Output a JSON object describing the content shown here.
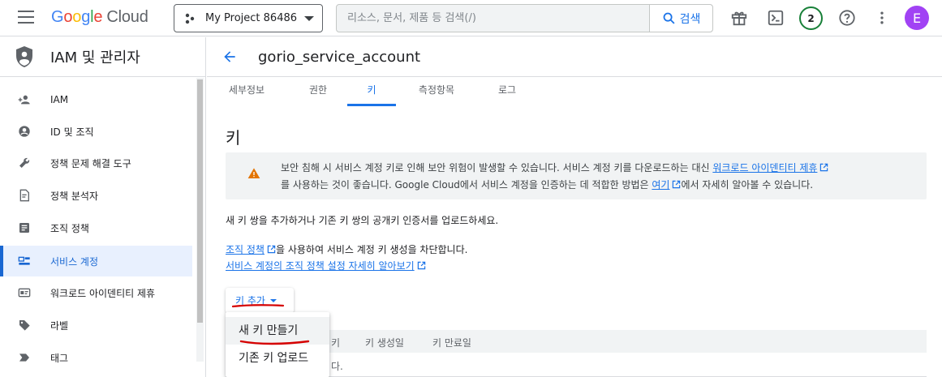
{
  "topbar": {
    "logo_letters": [
      "G",
      "o",
      "o",
      "g",
      "l",
      "e"
    ],
    "logo_suffix": "Cloud",
    "project": "My Project 86486",
    "search_placeholder": "리소스, 문서, 제품 등 검색(/)",
    "search_button": "검색",
    "notification_count": "2",
    "avatar_letter": "E"
  },
  "sidebar": {
    "title": "IAM 및 관리자",
    "items": [
      {
        "label": "IAM",
        "icon": "person-add-icon"
      },
      {
        "label": "ID 및 조직",
        "icon": "account-circle-icon"
      },
      {
        "label": "정책 문제 해결 도구",
        "icon": "wrench-icon"
      },
      {
        "label": "정책 분석자",
        "icon": "policy-doc-icon"
      },
      {
        "label": "조직 정책",
        "icon": "list-doc-icon"
      },
      {
        "label": "서비스 계정",
        "icon": "service-account-icon",
        "active": true
      },
      {
        "label": "워크로드 아이덴티티 제휴",
        "icon": "id-card-icon"
      },
      {
        "label": "라벨",
        "icon": "label-icon"
      },
      {
        "label": "태그",
        "icon": "tag-icon"
      }
    ]
  },
  "main": {
    "title": "gorio_service_account",
    "tabs": [
      {
        "label": "세부정보"
      },
      {
        "label": "권한"
      },
      {
        "label": "키",
        "active": true
      },
      {
        "label": "측정항목"
      },
      {
        "label": "로그"
      }
    ],
    "section_title": "키",
    "warning": {
      "text_1": "보안 침해 시 서비스 계정 키로 인해 보안 위험이 발생할 수 있습니다. 서비스 계정 키를 다운로드하는 대신 ",
      "link_1": "워크로드 아이덴티티 제휴",
      "text_2": "를 사용하는 것이 좋습니다. Google Cloud에서 서비스 계정을 인증하는 데 적합한 방법은 ",
      "link_2": "여기",
      "text_3": "에서 자세히 알아볼 수 있습니다."
    },
    "intro": "새 키 쌍을 추가하거나 기존 키 쌍의 공개키 인증서를 업로드하세요.",
    "policy_link": "조직 정책",
    "policy_text": "을 사용하여 서비스 계정 키 생성을 차단합니다.",
    "learn_more_link": "서비스 계정의 조직 정책 설정 자세히 알아보기",
    "add_key_button": "키 추가",
    "table_headers": [
      "키",
      "키 생성일",
      "키 만료일"
    ],
    "table_empty_fragment": "다.",
    "menu_items": [
      "새 키 만들기",
      "기존 키 업로드"
    ],
    "colors": {
      "accent": "#1a73e8",
      "warning": "#e37400",
      "annotation": "#d50000"
    }
  }
}
